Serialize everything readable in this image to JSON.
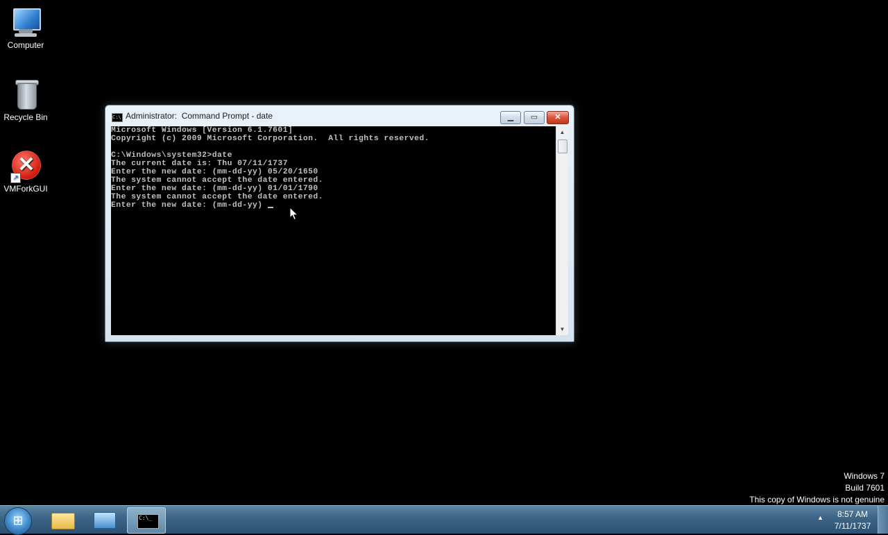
{
  "desktop": {
    "icons": [
      {
        "label": "Computer",
        "icon": "computer-icon"
      },
      {
        "label": "Recycle Bin",
        "icon": "recycle-bin-icon"
      },
      {
        "label": "VMForkGUI",
        "icon": "error-icon"
      }
    ]
  },
  "window": {
    "title": "Administrator:  Command Prompt - date",
    "console_lines": [
      "Microsoft Windows [Version 6.1.7601]",
      "Copyright (c) 2009 Microsoft Corporation.  All rights reserved.",
      "",
      "C:\\Windows\\system32>date",
      "The current date is: Thu 07/11/1737",
      "Enter the new date: (mm-dd-yy) 05/20/1650",
      "The system cannot accept the date entered.",
      "Enter the new date: (mm-dd-yy) 01/01/1790",
      "The system cannot accept the date entered.",
      "Enter the new date: (mm-dd-yy) "
    ]
  },
  "watermark": {
    "line1": "Windows 7",
    "line2": "Build 7601",
    "line3": "This copy of Windows is not genuine"
  },
  "taskbar": {
    "clock_time": "8:57 AM",
    "clock_date": "7/11/1737"
  }
}
